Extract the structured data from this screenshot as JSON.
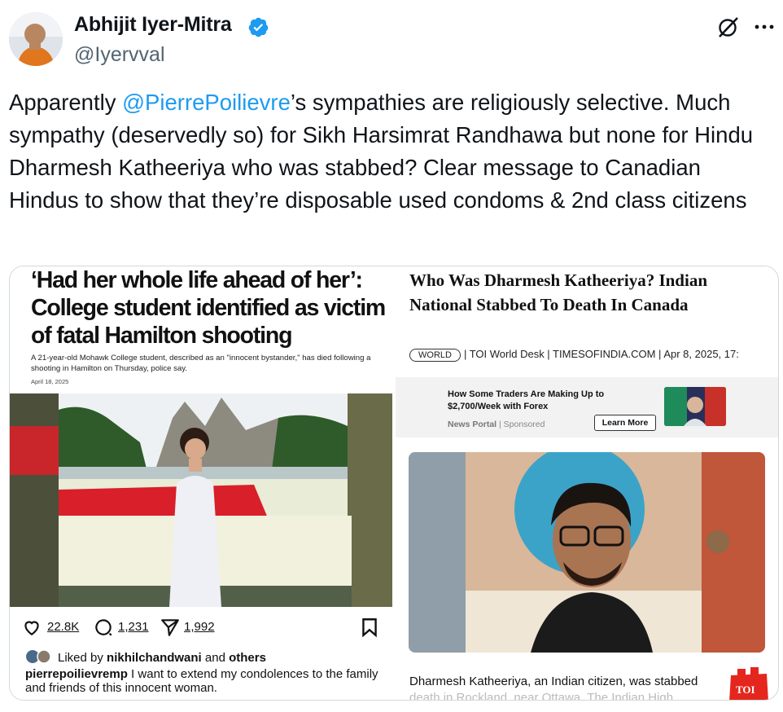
{
  "tweet": {
    "author_name": "Abhijit Iyer-Mitra",
    "handle": "@Iyervval",
    "text_before": "Apparently ",
    "mention": "@PierrePoilievre",
    "text_after": "’s sympathies are religiously selective. Much sympathy (deservedly so) for Sikh Harsimrat Randhawa but none for Hindu Dharmesh Katheeriya who was stabbed? Clear message to Canadian Hindus to show that they’re disposable used condoms & 2nd class citizens",
    "avatar_icon": "avatar-photo",
    "verified_icon": "verified-badge-icon",
    "grok_icon": "grok-icon",
    "more_icon": "more-icon",
    "accent_color": "#1d9bf0"
  },
  "left_image": {
    "headline": "‘Had her whole life ahead of her’: College student identified as victim of fatal Hamilton shooting",
    "subhead": "A 21-year-old Mohawk College student, described as an \"innocent bystander,\" has died following a shooting in Hamilton on Thursday, police say.",
    "date": "April 18, 2025",
    "likes": "22.8K",
    "comments": "1,231",
    "shares": "1,992",
    "liked_by_prefix": "Liked by ",
    "liked_by_user": "nikhilchandwani",
    "liked_by_and": " and ",
    "liked_by_others": "others",
    "caption_user": "pierrepoilievremp",
    "caption_text": " I want to extend my condolences to the family and friends of this innocent woman."
  },
  "right_image": {
    "headline": "Who Was Dharmesh Katheeriya? Indian National Stabbed To Death In Canada",
    "badge": "WORLD",
    "byline": "| TOI World Desk | TIMESOFINDIA.COM | Apr 8, 2025, 17:",
    "ad_title": "How Some Traders Are Making Up to $2,700/Week with Forex",
    "ad_source": "News Portal",
    "ad_sponsored": " | Sponsored",
    "ad_button": "Learn More",
    "body_text": "Dharmesh Katheeriya, an Indian citizen, was stabbed",
    "body_text_faded": "death in Rockland, near Ottawa. The Indian High",
    "logo_text": "TOI",
    "logo_color": "#e5261e"
  }
}
